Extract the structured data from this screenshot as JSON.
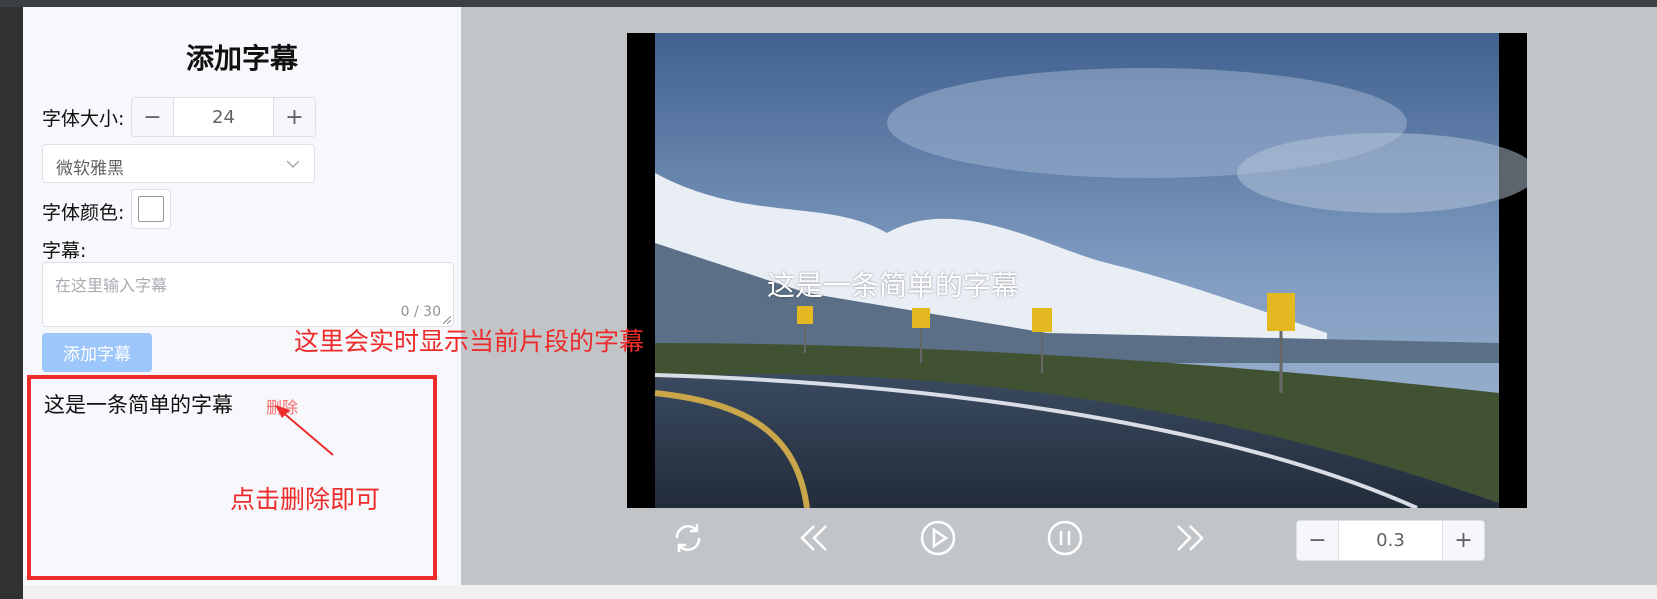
{
  "sidebar": {
    "title": "添加字幕",
    "font_size_label": "字体大小:",
    "font_size_value": "24",
    "font_family_value": "微软雅黑",
    "font_color_label": "字体颜色:",
    "font_color_value": "#ffffff",
    "subtitle_label": "字幕:",
    "subtitle_placeholder": "在这里输入字幕",
    "subtitle_counter": "0 / 30",
    "add_button_label": "添加字幕",
    "subtitle_list": [
      {
        "text": "这是一条简单的字幕",
        "delete_label": "删除"
      }
    ]
  },
  "annotations": {
    "realtime_note": "这里会实时显示当前片段的字幕",
    "delete_note": "点击删除即可"
  },
  "player": {
    "overlay_subtitle": "这是一条简单的字幕",
    "controls": [
      "refresh-icon",
      "rewind-icon",
      "play-icon",
      "pause-icon",
      "fast-forward-icon"
    ],
    "speed_value": "0.3"
  },
  "colors": {
    "accent_red": "#ee2b2b",
    "button_blue_disabled": "#9dc7fb",
    "delete_red": "#f56c6c"
  }
}
